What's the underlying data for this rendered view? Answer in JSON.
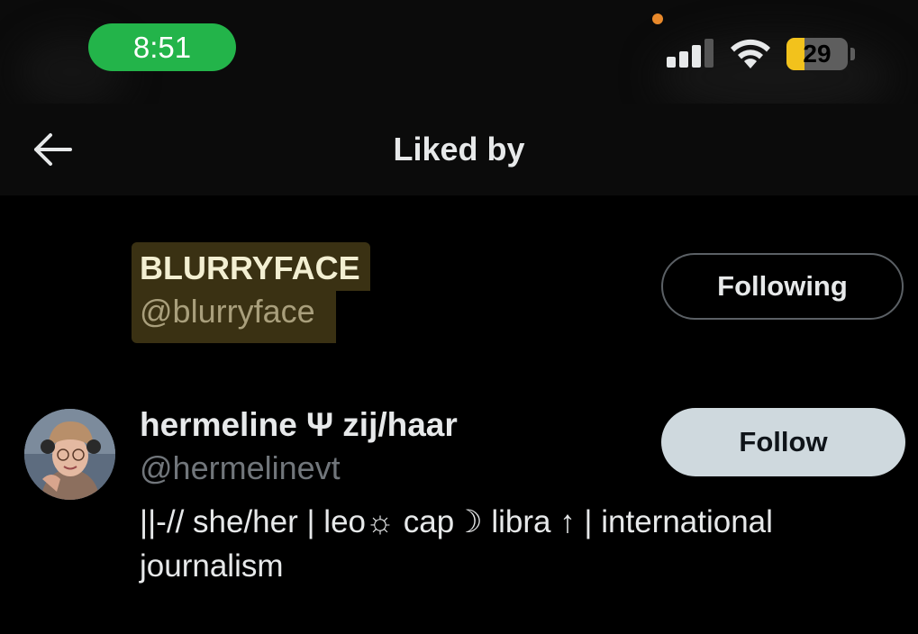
{
  "status_bar": {
    "time": "8:51",
    "battery_level": "29",
    "battery_color": "#f2c21c",
    "pill_color": "#23b44a"
  },
  "header": {
    "title": "Liked by",
    "back_icon": "arrow-left-icon"
  },
  "users": [
    {
      "display_name": "BLURRYFACE",
      "handle": "@blurryface",
      "button_label": "Following"
    },
    {
      "display_name": "hermeline Ψ zij/haar",
      "handle": "@hermelinevt",
      "bio": "||-// she/her | leo☼ cap☽ libra ↑ | international journalism",
      "button_label": "Follow"
    }
  ]
}
